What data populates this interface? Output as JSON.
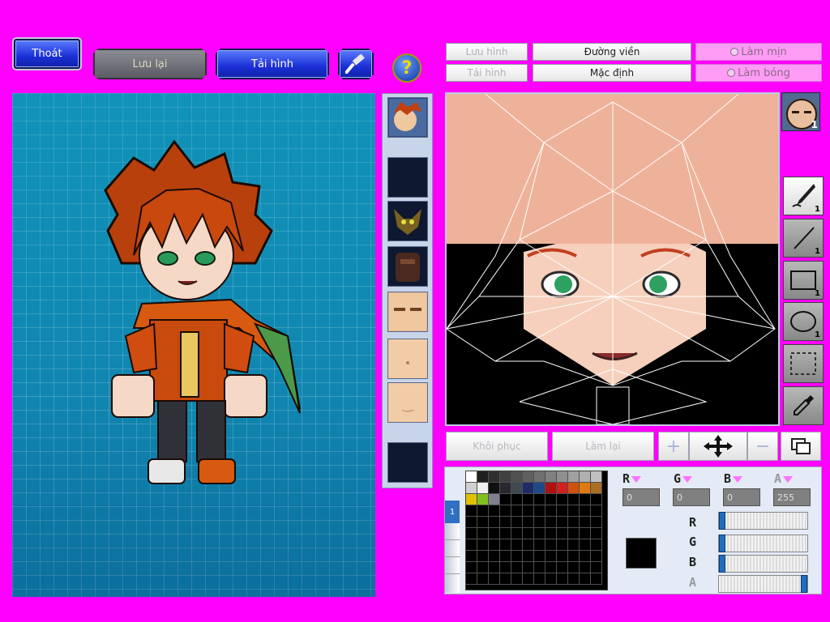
{
  "top_bar": {
    "exit_label": "Thoát",
    "save_label": "Lưu lại",
    "reload_label": "Tải hình",
    "hammer_icon": "hammer-icon",
    "help_icon": "question-icon"
  },
  "options": {
    "save_image": "Lưu hình",
    "reload_image": "Tải hình",
    "outline": "Đường viền",
    "default": "Mặc định",
    "smooth": "Làm mịn",
    "shading": "Làm bóng"
  },
  "layer_badge": "1",
  "tools": [
    {
      "name": "brush-tool",
      "icon": "brush-icon",
      "count": "1"
    },
    {
      "name": "line-tool",
      "icon": "line-icon",
      "count": "1"
    },
    {
      "name": "rectangle-tool",
      "icon": "rectangle-icon",
      "count": "1"
    },
    {
      "name": "ellipse-tool",
      "icon": "ellipse-icon",
      "count": "1"
    },
    {
      "name": "select-tool",
      "icon": "marquee-icon",
      "count": ""
    },
    {
      "name": "eyedropper-tool",
      "icon": "eyedropper-icon",
      "count": ""
    }
  ],
  "bottom": {
    "restore_label": "Khôi phục",
    "redo_label": "Làm lại"
  },
  "palette": {
    "tab_label": "1",
    "colors_row1": [
      "#ffffff",
      "#202020",
      "#303030",
      "#404040",
      "#505050",
      "#606060",
      "#707070",
      "#808080",
      "#909090",
      "#a0a0a0",
      "#b0b0b0",
      "#c0c0c0"
    ],
    "colors_row2": [
      "#d0d0d0",
      "#f0f0f0",
      "#101010",
      "#282830",
      "#404850",
      "#1e2a6a",
      "#1e4a8a",
      "#b01010",
      "#d02020",
      "#d05010",
      "#e07a10",
      "#a87020"
    ],
    "colors_row3": [
      "#e0c000",
      "#80c020",
      "#808090"
    ]
  },
  "color": {
    "r_label": "R",
    "g_label": "G",
    "b_label": "B",
    "a_label": "A",
    "r": "0",
    "g": "0",
    "b": "0",
    "a": "255",
    "current": "#000000",
    "r_fraction": 0.0,
    "g_fraction": 0.0,
    "b_fraction": 0.0,
    "a_fraction": 1.0
  }
}
